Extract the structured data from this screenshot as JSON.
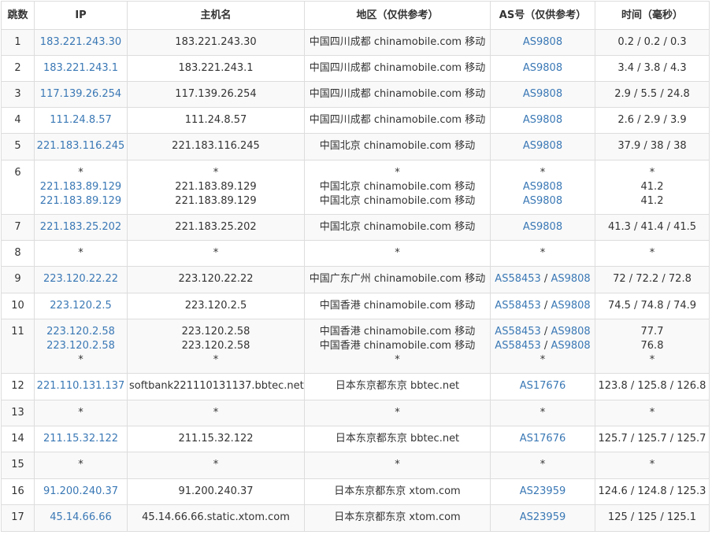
{
  "headers": {
    "hop": "跳数",
    "ip": "IP",
    "hostname": "主机名",
    "location": "地区（仅供参考）",
    "asn": "AS号（仅供参考）",
    "time": "时间（毫秒）"
  },
  "rows": [
    {
      "hop": "1",
      "lines": [
        {
          "ip": "183.221.243.30",
          "host": "183.221.243.30",
          "loc": "中国四川成都 chinamobile.com 移动",
          "as": [
            "AS9808"
          ],
          "time": "0.2 / 0.2 / 0.3"
        }
      ]
    },
    {
      "hop": "2",
      "lines": [
        {
          "ip": "183.221.243.1",
          "host": "183.221.243.1",
          "loc": "中国四川成都 chinamobile.com 移动",
          "as": [
            "AS9808"
          ],
          "time": "3.4 / 3.8 / 4.3"
        }
      ]
    },
    {
      "hop": "3",
      "lines": [
        {
          "ip": "117.139.26.254",
          "host": "117.139.26.254",
          "loc": "中国四川成都 chinamobile.com 移动",
          "as": [
            "AS9808"
          ],
          "time": "2.9 / 5.5 / 24.8"
        }
      ]
    },
    {
      "hop": "4",
      "lines": [
        {
          "ip": "111.24.8.57",
          "host": "111.24.8.57",
          "loc": "中国四川成都 chinamobile.com 移动",
          "as": [
            "AS9808"
          ],
          "time": "2.6 / 2.9 / 3.9"
        }
      ]
    },
    {
      "hop": "5",
      "lines": [
        {
          "ip": "221.183.116.245",
          "host": "221.183.116.245",
          "loc": "中国北京 chinamobile.com 移动",
          "as": [
            "AS9808"
          ],
          "time": "37.9 / 38 / 38"
        }
      ]
    },
    {
      "hop": "6",
      "lines": [
        {
          "ip": "*",
          "host": "*",
          "loc": "*",
          "as": [
            "*"
          ],
          "time": "*"
        },
        {
          "ip": "221.183.89.129",
          "host": "221.183.89.129",
          "loc": "中国北京 chinamobile.com 移动",
          "as": [
            "AS9808"
          ],
          "time": "41.2"
        },
        {
          "ip": "221.183.89.129",
          "host": "221.183.89.129",
          "loc": "中国北京 chinamobile.com 移动",
          "as": [
            "AS9808"
          ],
          "time": "41.2"
        }
      ]
    },
    {
      "hop": "7",
      "lines": [
        {
          "ip": "221.183.25.202",
          "host": "221.183.25.202",
          "loc": "中国北京 chinamobile.com 移动",
          "as": [
            "AS9808"
          ],
          "time": "41.3 / 41.4 / 41.5"
        }
      ]
    },
    {
      "hop": "8",
      "lines": [
        {
          "ip": "*",
          "host": "*",
          "loc": "*",
          "as": [
            "*"
          ],
          "time": "*"
        }
      ]
    },
    {
      "hop": "9",
      "lines": [
        {
          "ip": "223.120.22.22",
          "host": "223.120.22.22",
          "loc": "中国广东广州 chinamobile.com 移动",
          "as": [
            "AS58453",
            "AS9808"
          ],
          "time": "72 / 72.2 / 72.8"
        }
      ]
    },
    {
      "hop": "10",
      "lines": [
        {
          "ip": "223.120.2.5",
          "host": "223.120.2.5",
          "loc": "中国香港 chinamobile.com 移动",
          "as": [
            "AS58453",
            "AS9808"
          ],
          "time": "74.5 / 74.8 / 74.9"
        }
      ]
    },
    {
      "hop": "11",
      "lines": [
        {
          "ip": "223.120.2.58",
          "host": "223.120.2.58",
          "loc": "中国香港 chinamobile.com 移动",
          "as": [
            "AS58453",
            "AS9808"
          ],
          "time": "77.7"
        },
        {
          "ip": "223.120.2.58",
          "host": "223.120.2.58",
          "loc": "中国香港 chinamobile.com 移动",
          "as": [
            "AS58453",
            "AS9808"
          ],
          "time": "76.8"
        },
        {
          "ip": "*",
          "host": "*",
          "loc": "*",
          "as": [
            "*"
          ],
          "time": "*"
        }
      ]
    },
    {
      "hop": "12",
      "lines": [
        {
          "ip": "221.110.131.137",
          "host": "softbank221110131137.bbtec.net",
          "loc": "日本东京都东京 bbtec.net",
          "as": [
            "AS17676"
          ],
          "time": "123.8 / 125.8 / 126.8"
        }
      ]
    },
    {
      "hop": "13",
      "lines": [
        {
          "ip": "*",
          "host": "*",
          "loc": "*",
          "as": [
            "*"
          ],
          "time": "*"
        }
      ]
    },
    {
      "hop": "14",
      "lines": [
        {
          "ip": "211.15.32.122",
          "host": "211.15.32.122",
          "loc": "日本东京都东京 bbtec.net",
          "as": [
            "AS17676"
          ],
          "time": "125.7 / 125.7 / 125.7"
        }
      ]
    },
    {
      "hop": "15",
      "lines": [
        {
          "ip": "*",
          "host": "*",
          "loc": "*",
          "as": [
            "*"
          ],
          "time": "*"
        }
      ]
    },
    {
      "hop": "16",
      "lines": [
        {
          "ip": "91.200.240.37",
          "host": "91.200.240.37",
          "loc": "日本东京都东京 xtom.com",
          "as": [
            "AS23959"
          ],
          "time": "124.6 / 124.8 / 125.3"
        }
      ]
    },
    {
      "hop": "17",
      "lines": [
        {
          "ip": "45.14.66.66",
          "host": "45.14.66.66.static.xtom.com",
          "loc": "日本东京都东京 xtom.com",
          "as": [
            "AS23959"
          ],
          "time": "125 / 125 / 125.1"
        }
      ]
    }
  ]
}
